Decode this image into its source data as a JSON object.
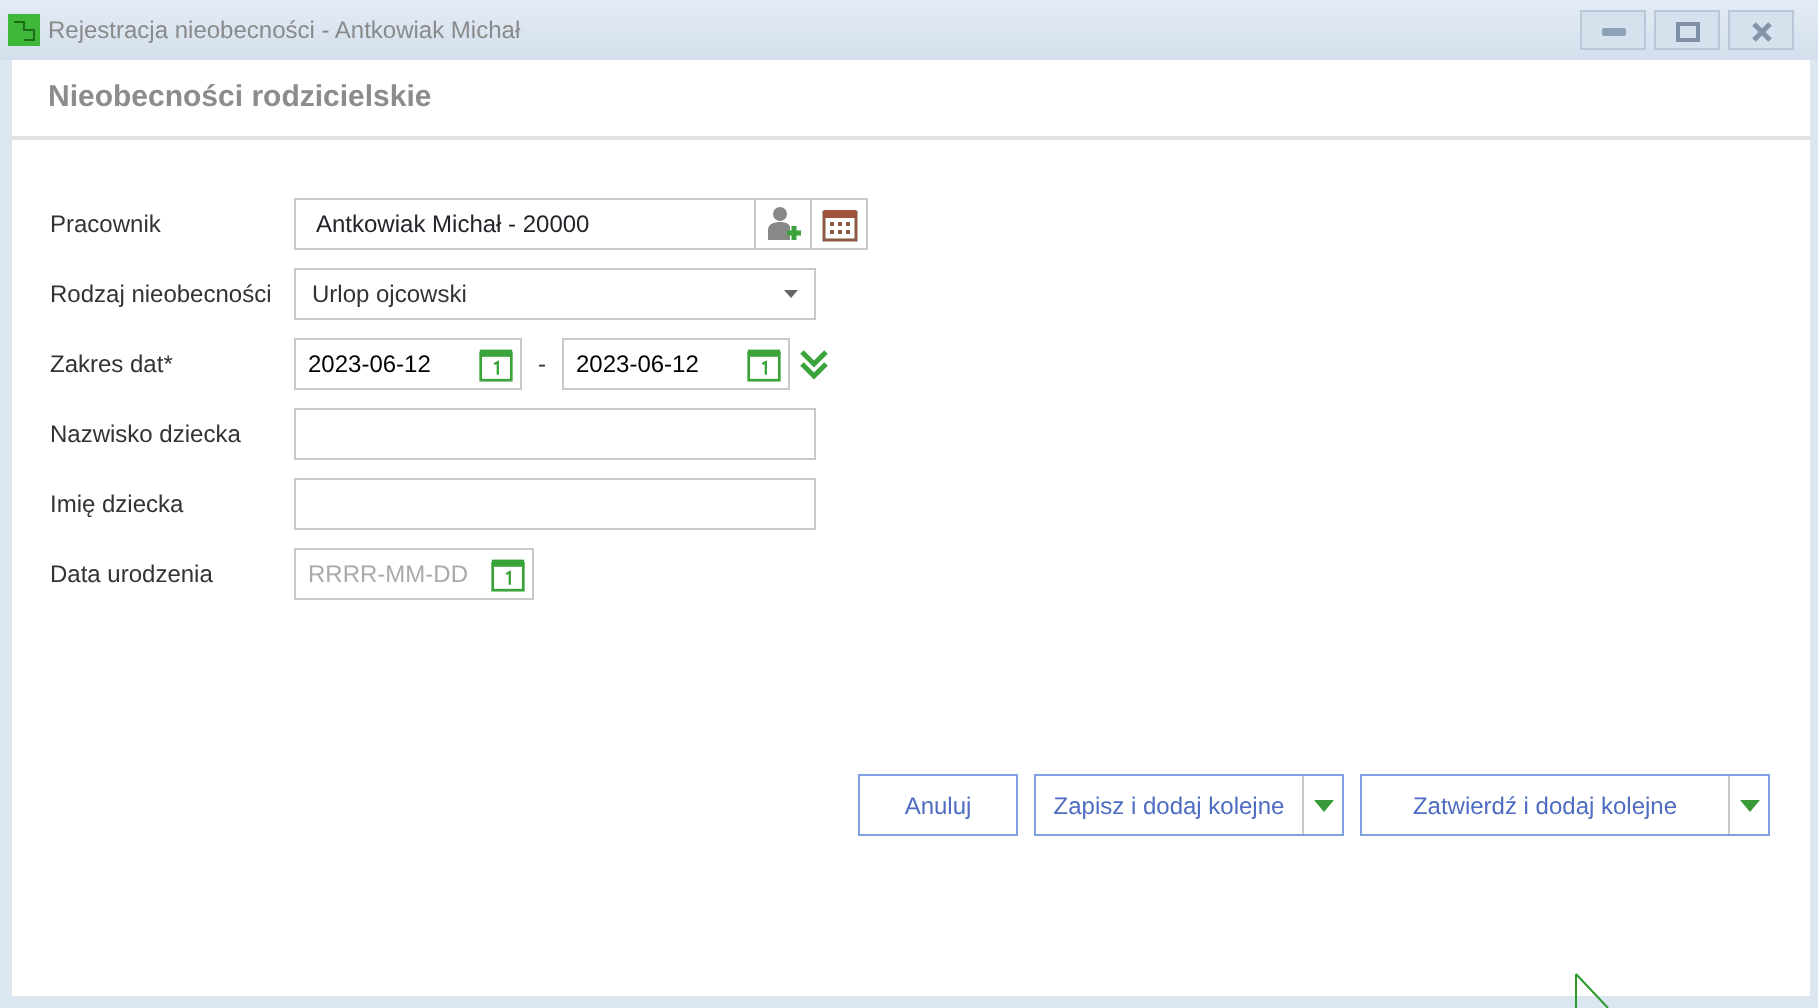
{
  "window": {
    "title": "Rejestracja nieobecności - Antkowiak Michał"
  },
  "heading": "Nieobecności rodzicielskie",
  "fields": [
    {
      "kind": "lookup",
      "label": "Pracownik",
      "value": "Antkowiak Michał - 20000"
    },
    {
      "kind": "select",
      "label": "Rodzaj nieobecności",
      "value": "Urlop ojcowski"
    },
    {
      "kind": "daterange",
      "label": "Zakres dat*",
      "from": "2023-06-12",
      "separator": "-",
      "to": "2023-06-12"
    },
    {
      "kind": "text",
      "label": "Nazwisko dziecka"
    },
    {
      "kind": "text",
      "label": "Imię dziecka"
    },
    {
      "kind": "date",
      "label": "Data urodzenia",
      "placeholder": "RRRR-MM-DD"
    }
  ],
  "buttons": [
    {
      "kind": "plain",
      "label": "Anuluj"
    },
    {
      "kind": "split",
      "label": "Zapisz i dodaj kolejne"
    },
    {
      "kind": "split",
      "label": "Zatwierdź i dodaj kolejne"
    }
  ]
}
